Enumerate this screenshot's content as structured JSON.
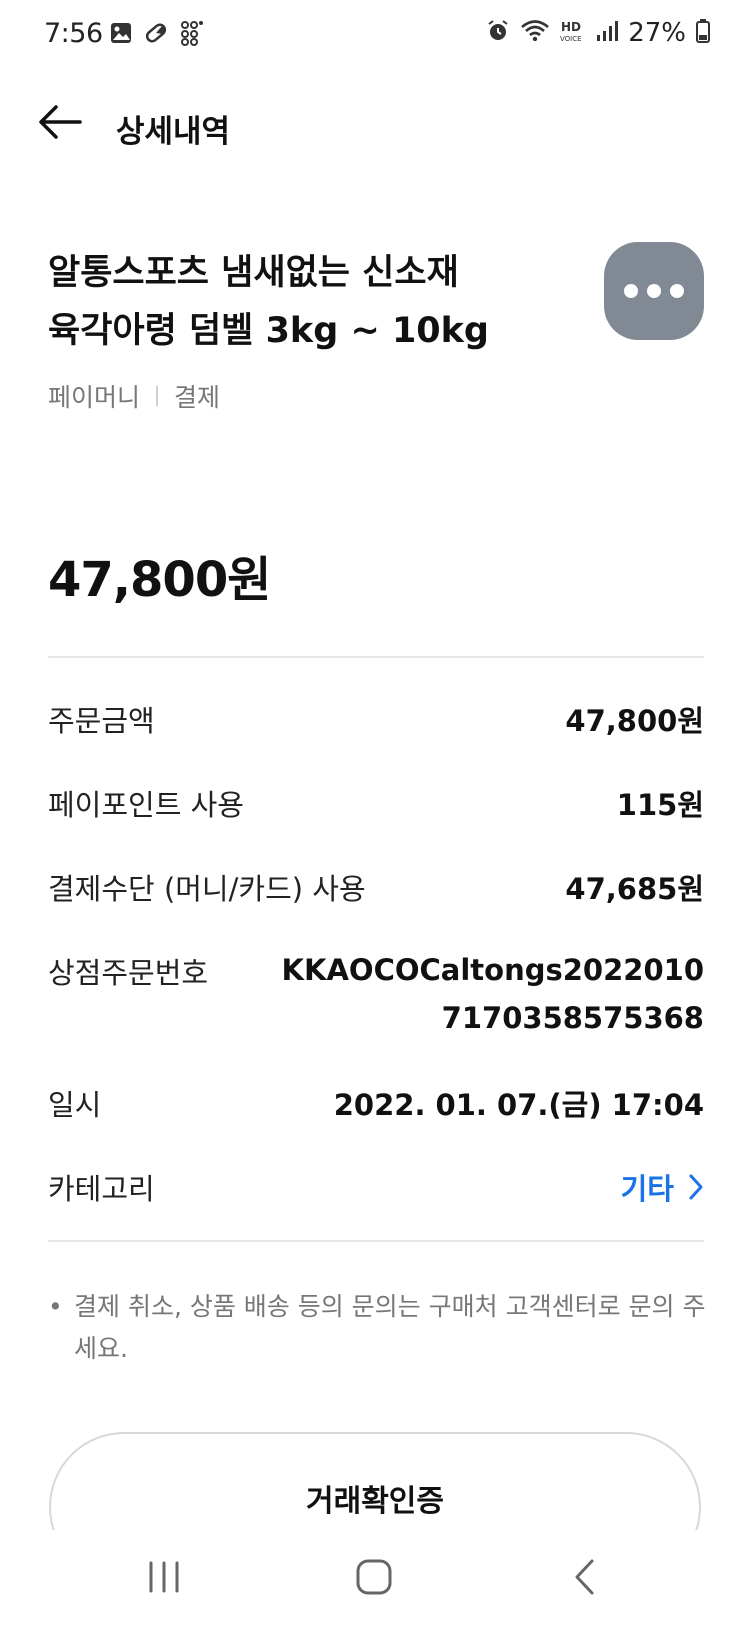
{
  "status_bar": {
    "time": "7:56",
    "battery": "27%",
    "left_icons": [
      "gallery-icon",
      "pill-icon",
      "dots-icon"
    ],
    "right_icons": [
      "alarm-icon",
      "wifi-icon",
      "hd-voice-icon",
      "signal-icon",
      "battery-icon"
    ]
  },
  "header": {
    "title": "상세내역"
  },
  "product": {
    "title": "알통스포츠 냄새없는 신소재 육각아령 덤벨 3kg ~ 10kg",
    "source": "페이머니",
    "type": "결제"
  },
  "amount": "47,800원",
  "details": {
    "order_amount_label": "주문금액",
    "order_amount_value": "47,800원",
    "point_label": "페이포인트 사용",
    "point_value": "115원",
    "method_label": "결제수단 (머니/카드) 사용",
    "method_value": "47,685원",
    "order_no_label": "상점주문번호",
    "order_no_value": "KKAOCOCaltongs20220107170358575368",
    "datetime_label": "일시",
    "datetime_value": "2022. 01. 07.(금) 17:04",
    "category_label": "카테고리",
    "category_value": "기타"
  },
  "notice": {
    "bullet": "•",
    "text": "결제 취소, 상품 배송 등의 문의는 구매처 고객센터로 문의 주세요."
  },
  "confirm_button_label": "거래확인증",
  "colors": {
    "accent": "#1a73e8",
    "more_button": "#818a94",
    "muted_text": "#777777"
  }
}
